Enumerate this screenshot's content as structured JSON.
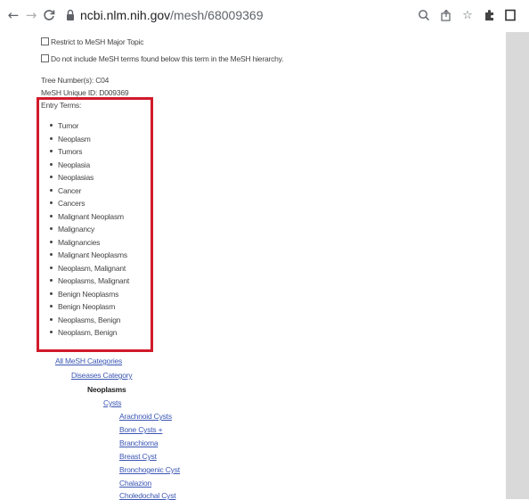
{
  "browser": {
    "url_host": "ncbi.nlm.nih.gov",
    "url_path": "/mesh/68009369"
  },
  "options": {
    "major_topic": "Restrict to MeSH Major Topic",
    "no_explode": "Do not include MeSH terms found below this term in the MeSH hierarchy."
  },
  "meta": {
    "tree_number": "Tree Number(s): C04",
    "unique_id": "MeSH Unique ID: D009369",
    "entry_terms_label": "Entry Terms:"
  },
  "entry_terms": [
    "Tumor",
    "Neoplasm",
    "Tumors",
    "Neoplasia",
    "Neoplasias",
    "Cancer",
    "Cancers",
    "Malignant Neoplasm",
    "Malignancy",
    "Malignancies",
    "Malignant Neoplasms",
    "Neoplasm, Malignant",
    "Neoplasms, Malignant",
    "Benign Neoplasms",
    "Benign Neoplasm",
    "Neoplasms, Benign",
    "Neoplasm, Benign"
  ],
  "tree": {
    "root": "All MeSH Categories",
    "category": "Diseases Category",
    "current": "Neoplasms",
    "child": "Cysts",
    "grandchildren": [
      "Arachnoid Cysts",
      "Bone Cysts +",
      "Branchioma",
      "Breast Cyst",
      "Bronchogenic Cyst",
      "Chalazion",
      "Choledochal Cyst"
    ]
  },
  "colors": {
    "highlight": "#d11a2a",
    "link": "#3b56b4"
  }
}
